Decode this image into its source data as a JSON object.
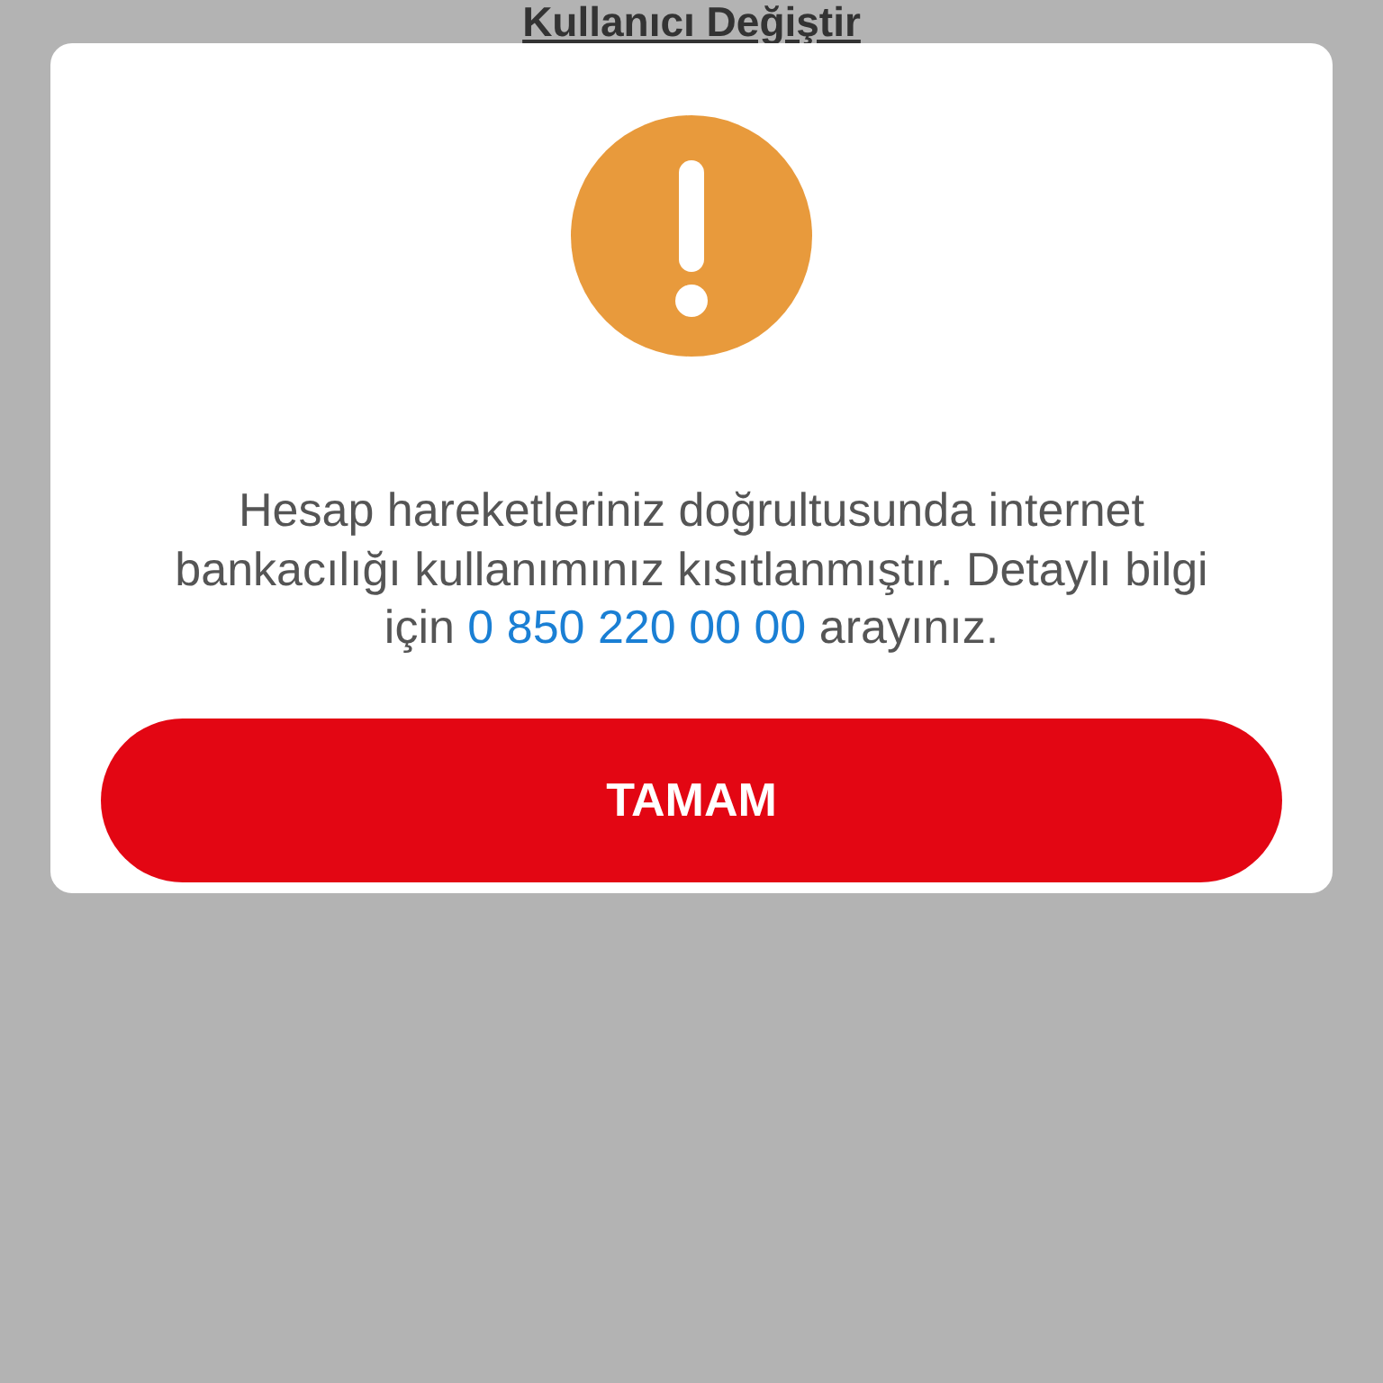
{
  "header_link": "Kullanıcı Değiştir",
  "dialog": {
    "message": {
      "before": "Hesap hareketleriniz doğrultusunda internet bankacılığı kullanımınız kısıtlanmıştır. Detaylı bilgi için ",
      "phone": "0 850 220 00 00",
      "after": " arayınız."
    },
    "button": "TAMAM"
  }
}
